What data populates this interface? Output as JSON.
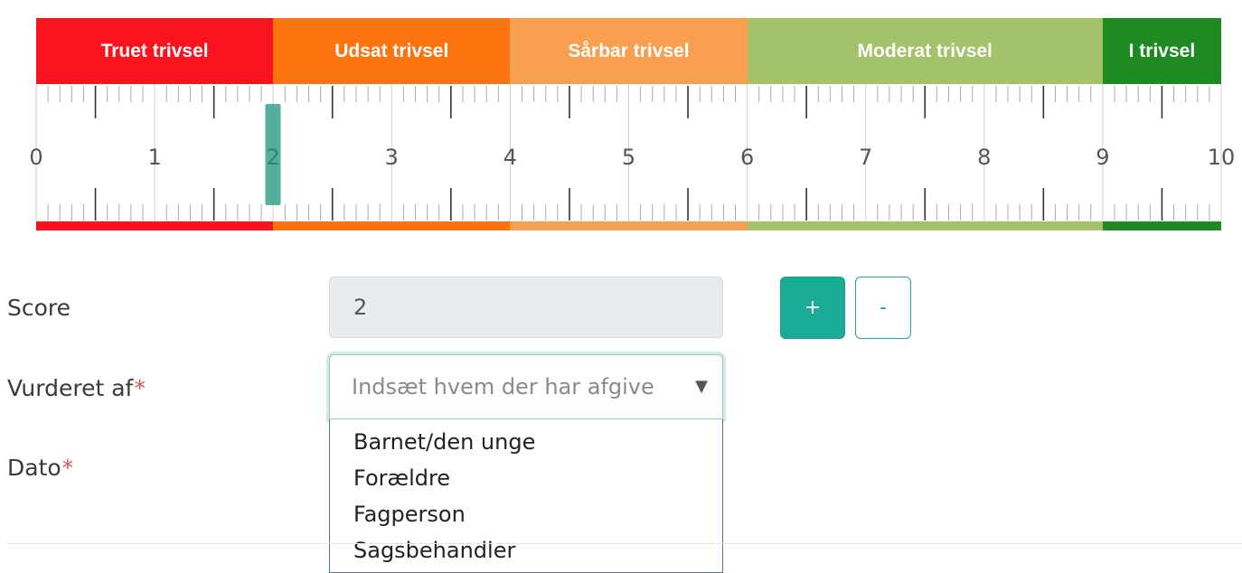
{
  "scale": {
    "min": 0,
    "max": 10,
    "tick_labels": [
      "0",
      "1",
      "2",
      "3",
      "4",
      "5",
      "6",
      "7",
      "8",
      "9",
      "10"
    ],
    "bands": [
      {
        "label": "Truet trivsel",
        "from": 0,
        "to": 2,
        "color": "#f8131f"
      },
      {
        "label": "Udsat trivsel",
        "from": 2,
        "to": 4,
        "color": "#fb7410"
      },
      {
        "label": "Sårbar trivsel",
        "from": 4,
        "to": 6,
        "color": "#f8a050"
      },
      {
        "label": "Moderat trivsel",
        "from": 6,
        "to": 9,
        "color": "#a3c26a"
      },
      {
        "label": "I trivsel",
        "from": 9,
        "to": 10,
        "color": "#1e8b22"
      }
    ],
    "marker_value": 2
  },
  "form": {
    "score_label": "Score",
    "score_value": "2",
    "plus_label": "+",
    "minus_label": "-",
    "assessed_by_label": "Vurderet af",
    "assessed_by_placeholder": "Indsæt hvem der har afgive",
    "date_label": "Dato",
    "required_mark": "*",
    "dropdown_options": [
      "Barnet/den unge",
      "Forældre",
      "Fagperson",
      "Sagsbehandler"
    ]
  },
  "colors": {
    "accent": "#1aab97"
  },
  "icons": {
    "caret": "caret-down-icon"
  }
}
